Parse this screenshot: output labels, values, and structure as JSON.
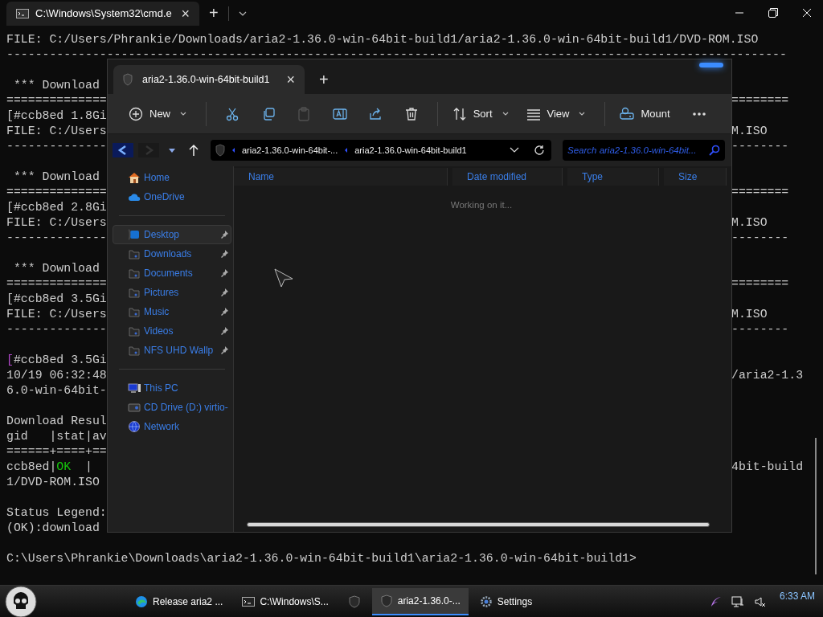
{
  "terminal": {
    "tab": {
      "title": "C:\\Windows\\System32\\cmd.e",
      "close": "×"
    },
    "new_tab": "+",
    "blocks": [
      [
        {
          "parts": [
            {
              "text": "FILE: C:/Users/Phrankie/Downloads/aria2-1.36.0-win-64bit-build1/aria2-1.36.0-win-64bit-build1/DVD-ROM.ISO"
            }
          ]
        },
        {
          "parts": [
            {
              "text": "-------------------------------------------------------------------------------------------------------------"
            }
          ]
        }
      ],
      [
        {
          "parts": [
            {
              "text": " *** Download"
            }
          ]
        },
        {
          "parts": [
            {
              "text": "=============="
            }
          ],
          "right": "========"
        },
        {
          "parts": [
            {
              "text": "[#ccb8ed 1.8Gi"
            }
          ]
        },
        {
          "parts": [
            {
              "text": "FILE: C:/Users"
            }
          ],
          "right": "M.ISO"
        },
        {
          "parts": [
            {
              "text": "--------------"
            }
          ],
          "right": "--------"
        }
      ],
      [
        {
          "parts": [
            {
              "text": " *** Download"
            }
          ]
        },
        {
          "parts": [
            {
              "text": "=============="
            }
          ],
          "right": "========"
        },
        {
          "parts": [
            {
              "text": "[#ccb8ed 2.8Gi"
            }
          ]
        },
        {
          "parts": [
            {
              "text": "FILE: C:/Users"
            }
          ],
          "right": "M.ISO"
        },
        {
          "parts": [
            {
              "text": "--------------"
            }
          ],
          "right": "--------"
        }
      ],
      [
        {
          "parts": [
            {
              "text": " *** Download"
            }
          ]
        },
        {
          "parts": [
            {
              "text": "=============="
            }
          ],
          "right": "========"
        },
        {
          "parts": [
            {
              "text": "[#ccb8ed 3.5Gi"
            }
          ]
        },
        {
          "parts": [
            {
              "text": "FILE: C:/Users"
            }
          ],
          "right": "M.ISO"
        },
        {
          "parts": [
            {
              "text": "--------------"
            }
          ],
          "right": "--------"
        }
      ],
      [
        {
          "parts": [
            {
              "text": "[",
              "color": "#b048c8"
            },
            {
              "text": "#ccb8ed 3.5Gi"
            }
          ]
        },
        {
          "parts": [
            {
              "text": "10/19 06:32:48"
            }
          ],
          "right": "/aria2-1.3"
        },
        {
          "parts": [
            {
              "text": "6.0-win-64bit-"
            }
          ]
        }
      ],
      [
        {
          "parts": [
            {
              "text": "Download Resul"
            }
          ]
        },
        {
          "parts": [
            {
              "text": "gid   |stat|av"
            }
          ]
        },
        {
          "parts": [
            {
              "text": "======+====+=="
            }
          ]
        },
        {
          "parts": [
            {
              "text": "ccb8ed|"
            },
            {
              "text": "OK",
              "color": "#16c60c"
            },
            {
              "text": "  |"
            }
          ],
          "right": "4bit-build"
        },
        {
          "parts": [
            {
              "text": "1/DVD-ROM.ISO"
            }
          ]
        }
      ],
      [
        {
          "parts": [
            {
              "text": "Status Legend:"
            }
          ]
        },
        {
          "parts": [
            {
              "text": "(OK):download"
            }
          ]
        }
      ],
      [
        {
          "parts": [
            {
              "text": "C:\\Users\\Phrankie\\Downloads\\aria2-1.36.0-win-64bit-build1\\aria2-1.36.0-win-64bit-build1>"
            }
          ]
        }
      ]
    ]
  },
  "explorer": {
    "tab": {
      "title": "aria2-1.36.0-win-64bit-build1",
      "close": "×"
    },
    "new_tab": "+",
    "toolbar": [
      {
        "kind": "menu",
        "label": "New",
        "disabled": false
      },
      {
        "kind": "divider"
      },
      {
        "kind": "icon",
        "disabled": false
      },
      {
        "kind": "icon",
        "disabled": false
      },
      {
        "kind": "icon",
        "disabled": true
      },
      {
        "kind": "icon",
        "disabled": false
      },
      {
        "kind": "icon",
        "disabled": false
      },
      {
        "kind": "icon",
        "disabled": false
      },
      {
        "kind": "divider"
      },
      {
        "kind": "menu",
        "label": "Sort",
        "disabled": false
      },
      {
        "kind": "menu",
        "label": "View",
        "disabled": false
      },
      {
        "kind": "divider"
      },
      {
        "kind": "button",
        "label": "Mount",
        "disabled": false
      },
      {
        "kind": "icon",
        "disabled": false
      }
    ],
    "address": {
      "crumbs": [
        "aria2-1.36.0-win-64bit-...",
        "aria2-1.36.0-win-64bit-build1"
      ]
    },
    "search": {
      "placeholder": "Search aria2-1.36.0-win-64bit..."
    },
    "nav": [
      {
        "kind": "item",
        "label": "Home",
        "selected": false,
        "pinned": false
      },
      {
        "kind": "item",
        "label": "OneDrive",
        "selected": false,
        "pinned": false
      },
      {
        "kind": "divider"
      },
      {
        "kind": "item",
        "label": "Desktop",
        "selected": true,
        "pinned": true
      },
      {
        "kind": "item",
        "label": "Downloads",
        "selected": false,
        "pinned": true
      },
      {
        "kind": "item",
        "label": "Documents",
        "selected": false,
        "pinned": true
      },
      {
        "kind": "item",
        "label": "Pictures",
        "selected": false,
        "pinned": true
      },
      {
        "kind": "item",
        "label": "Music",
        "selected": false,
        "pinned": true
      },
      {
        "kind": "item",
        "label": "Videos",
        "selected": false,
        "pinned": true
      },
      {
        "kind": "item",
        "label": "NFS UHD Wallp",
        "selected": false,
        "pinned": true
      },
      {
        "kind": "divider"
      },
      {
        "kind": "item",
        "label": "This PC",
        "selected": false,
        "pinned": false
      },
      {
        "kind": "item",
        "label": "CD Drive (D:) virtio-",
        "selected": false,
        "pinned": false
      },
      {
        "kind": "item",
        "label": "Network",
        "selected": false,
        "pinned": false
      }
    ],
    "columns": [
      "Name",
      "Date modified",
      "Type",
      "Size"
    ],
    "status": "Working on it..."
  },
  "taskbar": {
    "items": [
      {
        "label": "Release aria2 ...",
        "selected": false
      },
      {
        "label": "C:\\Windows\\S...",
        "selected": false
      },
      {
        "selected": false
      },
      {
        "label": "aria2-1.36.0-...",
        "selected": true
      },
      {
        "label": "Settings",
        "selected": false
      }
    ],
    "clock": "6:33 AM"
  }
}
